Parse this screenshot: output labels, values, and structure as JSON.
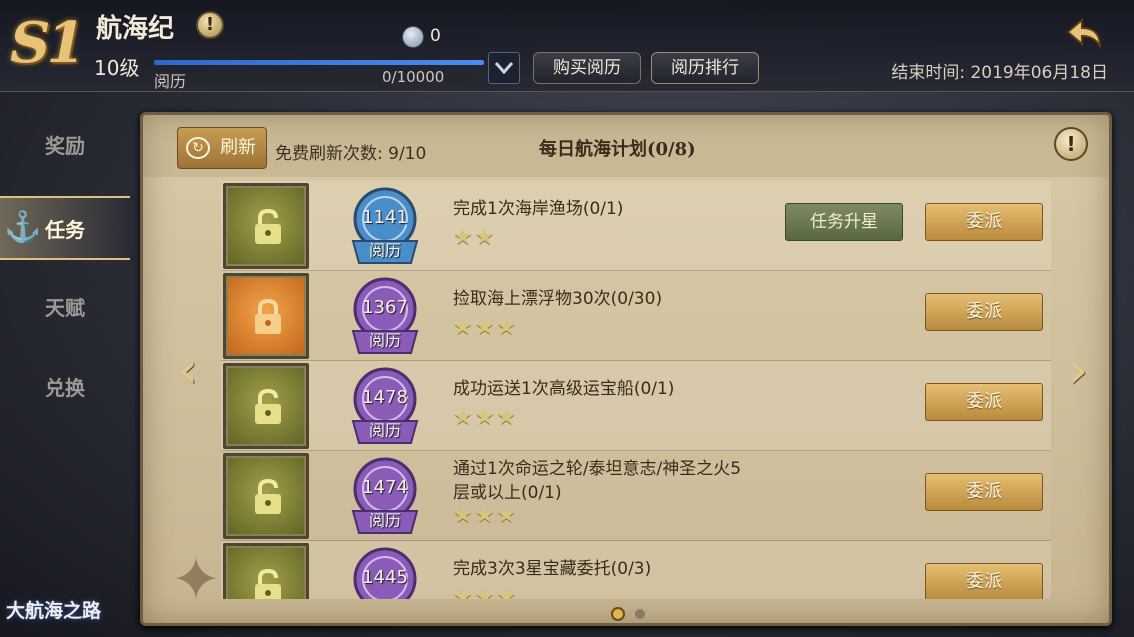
{
  "header": {
    "season": "S1",
    "game_title": "航海纪",
    "info_glyph": "!",
    "level": "10级",
    "progress_label": "阅历",
    "progress_value": "0/10000",
    "progress_fraction": 0.0,
    "coin_value": "0",
    "buy_button": "购买阅历",
    "rank_button": "阅历排行",
    "end_time": "结束时间: 2019年06月18日",
    "back_icon": "back-arrow-icon"
  },
  "sidebar": {
    "items": [
      {
        "label": "奖励",
        "active": false
      },
      {
        "label": "任务",
        "active": true
      },
      {
        "label": "天赋",
        "active": false
      },
      {
        "label": "兑换",
        "active": false
      }
    ]
  },
  "logo": "大航海之路",
  "panel": {
    "refresh_button": "刷新",
    "free_refresh_label": "免费刷新次数: 9/10",
    "plan_title": "每日航海计划(0/8)",
    "info_glyph": "!",
    "nav_left": "‹",
    "nav_right": "›"
  },
  "tasks": [
    {
      "lock_color": "olive",
      "medal_value": "1141",
      "medal_label": "阅历",
      "medal_color": "#4a8ec9",
      "description": "完成1次海岸渔场(0/1)",
      "stars": 2,
      "upgrade_button": "任务升星",
      "assign_button": "委派"
    },
    {
      "lock_color": "orange",
      "medal_value": "1367",
      "medal_label": "阅历",
      "medal_color": "#8a5cb8",
      "description": "捡取海上漂浮物30次(0/30)",
      "stars": 3,
      "upgrade_button": "",
      "assign_button": "委派"
    },
    {
      "lock_color": "olive",
      "medal_value": "1478",
      "medal_label": "阅历",
      "medal_color": "#8a5cb8",
      "description": "成功运送1次高级运宝船(0/1)",
      "stars": 3,
      "upgrade_button": "",
      "assign_button": "委派"
    },
    {
      "lock_color": "olive",
      "medal_value": "1474",
      "medal_label": "阅历",
      "medal_color": "#8a5cb8",
      "description": "通过1次命运之轮/泰坦意志/神圣之火5层或以上(0/1)",
      "stars": 3,
      "upgrade_button": "",
      "assign_button": "委派"
    },
    {
      "lock_color": "olive",
      "medal_value": "1445",
      "medal_label": "阅历",
      "medal_color": "#8a5cb8",
      "description": "完成3次3星宝藏委托(0/3)",
      "stars": 3,
      "upgrade_button": "",
      "assign_button": "委派"
    }
  ],
  "pagination": {
    "pages": 2,
    "current": 0
  },
  "colors": {
    "accent_gold": "#e2b44a",
    "parchment": "#d8c9a7",
    "progress_blue": "#2f68c9"
  }
}
